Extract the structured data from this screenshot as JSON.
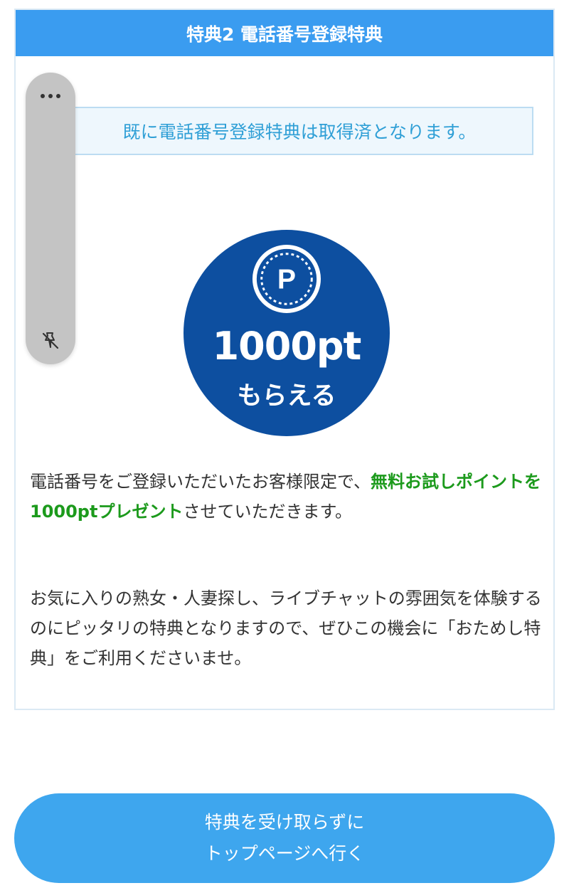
{
  "card": {
    "title": "特典2  電話番号登録特典",
    "notice": "既に電話番号登録特典は取得済となります。"
  },
  "points": {
    "icon_letter": "P",
    "value": "1000pt",
    "sub": "もらえる"
  },
  "description": {
    "para1_before": "電話番号をご登録いただいたお客様限定で、",
    "para1_highlight": "無料お試しポイントを1000ptプレゼント",
    "para1_after": "させていただきます。",
    "para2": "お気に入りの熟女・人妻探し、ライブチャットの雰囲気を体験するのにピッタリの特典となりますので、ぜひこの機会に「おためし特典」をご利用くださいませ。"
  },
  "side_panel": {
    "icons": [
      "more-icon",
      "pin-off-icon"
    ]
  },
  "button": {
    "line1": "特典を受け取らずに",
    "line2": "トップページへ行く"
  },
  "colors": {
    "header_bg": "#3a9cf0",
    "notice_text": "#2f9fd6",
    "circle_bg": "#0d4fa0",
    "highlight": "#1c9a1c",
    "button_bg": "#3ea6ee"
  }
}
